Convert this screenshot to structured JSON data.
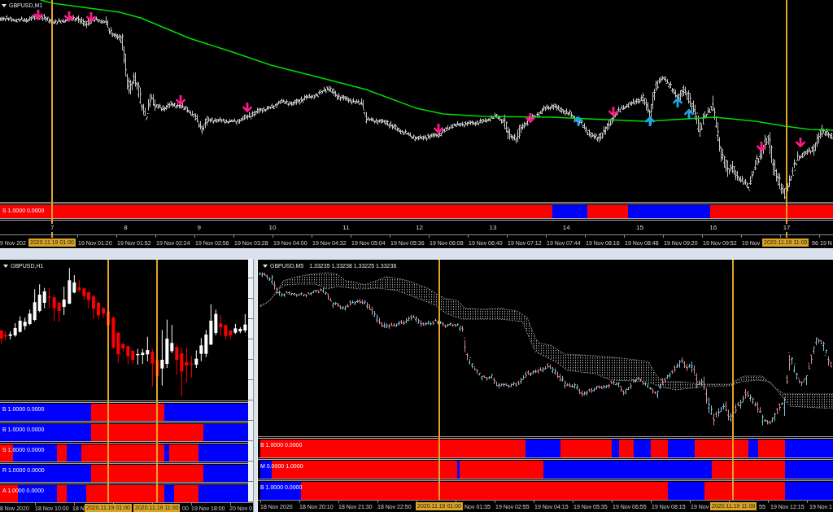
{
  "m1_chart": {
    "title": "GBPUSD,M1",
    "signal_strip": {
      "label": "S 1.0000 0.0000"
    },
    "bar_numbers": [
      "7",
      "8",
      "9",
      "10",
      "11",
      "12",
      "13",
      "14",
      "15",
      "16",
      "17"
    ],
    "time_axis": [
      {
        "kind": "label",
        "text": "9 Nov 202"
      },
      {
        "kind": "marker",
        "text": "2020.11.19 01:00"
      },
      {
        "kind": "label",
        "text": "19 Nov 01:20"
      },
      {
        "kind": "label",
        "text": "19 Nov 01:52"
      },
      {
        "kind": "label",
        "text": "19 Nov 02:24"
      },
      {
        "kind": "label",
        "text": "19 Nov 02:56"
      },
      {
        "kind": "label",
        "text": "19 Nov 03:28"
      },
      {
        "kind": "label",
        "text": "19 Nov 04:00"
      },
      {
        "kind": "label",
        "text": "19 Nov 04:32"
      },
      {
        "kind": "label",
        "text": "19 Nov 05:04"
      },
      {
        "kind": "label",
        "text": "19 Nov 05:36"
      },
      {
        "kind": "label",
        "text": "19 Nov 06:08"
      },
      {
        "kind": "label",
        "text": "19 Nov 06:40"
      },
      {
        "kind": "label",
        "text": "19 Nov 07:12"
      },
      {
        "kind": "label",
        "text": "19 Nov 07:44"
      },
      {
        "kind": "label",
        "text": "19 Nov 08:16"
      },
      {
        "kind": "label",
        "text": "19 Nov 08:48"
      },
      {
        "kind": "label",
        "text": "19 Nov 09:20"
      },
      {
        "kind": "label",
        "text": "19 Nov 09:52"
      },
      {
        "kind": "label",
        "text": "19 Nov"
      },
      {
        "kind": "marker",
        "text": "2020.11.19 11:00"
      },
      {
        "kind": "label",
        "text": "56"
      },
      {
        "kind": "label",
        "text": "19 N"
      }
    ]
  },
  "h1_chart": {
    "title": "GBPUSD,H1",
    "signal_strips": [
      {
        "label": "B 1.0000 0.0000"
      },
      {
        "label": "B 1.0000 0.0000"
      },
      {
        "label": "S 1.0000 0.0000"
      },
      {
        "label": "R 1.0000 0.0000"
      },
      {
        "label": "A 1.0000 0.0000"
      }
    ],
    "time_axis": [
      {
        "kind": "label",
        "text": "8 Nov 2020"
      },
      {
        "kind": "label",
        "text": "18 Nov 10:00"
      },
      {
        "kind": "label",
        "text": "18 N"
      },
      {
        "kind": "marker",
        "text": "2020.11.19 01:00"
      },
      {
        "kind": "marker",
        "text": "2020.11.19 11:00"
      },
      {
        "kind": "label",
        "text": "00"
      },
      {
        "kind": "label",
        "text": "19 Nov 18:00"
      },
      {
        "kind": "label",
        "text": "20 Nov 0"
      }
    ]
  },
  "m5_chart": {
    "title": "GBPUSD,M5",
    "quote": "1.33235 1.33238 1.33225 1.33236",
    "signal_strips": [
      {
        "label": "B 1.0000 0.0000"
      },
      {
        "label": "M 0.0000 1.0000"
      },
      {
        "label": "B 1.0000 0.0000"
      }
    ],
    "time_axis": [
      {
        "kind": "label",
        "text": "18 Nov 2020"
      },
      {
        "kind": "label",
        "text": "18 Nov 20:10"
      },
      {
        "kind": "label",
        "text": "18 Nov 21:30"
      },
      {
        "kind": "label",
        "text": "18 Nov 22:50"
      },
      {
        "kind": "marker",
        "text": "2020.11.19 01:00"
      },
      {
        "kind": "label",
        "text": "Nov 01:35"
      },
      {
        "kind": "label",
        "text": "19 Nov 02:55"
      },
      {
        "kind": "label",
        "text": "19 Nov 04:15"
      },
      {
        "kind": "label",
        "text": "19 Nov 05:35"
      },
      {
        "kind": "label",
        "text": "19 Nov 06:55"
      },
      {
        "kind": "label",
        "text": "19 Nov 08:15"
      },
      {
        "kind": "label",
        "text": "19 Nov"
      },
      {
        "kind": "marker",
        "text": "2020.11.19 11:00"
      },
      {
        "kind": "label",
        "text": "55"
      },
      {
        "kind": "label",
        "text": "19 Nov 12:15"
      },
      {
        "kind": "label",
        "text": "19 Nov 1"
      }
    ]
  }
}
